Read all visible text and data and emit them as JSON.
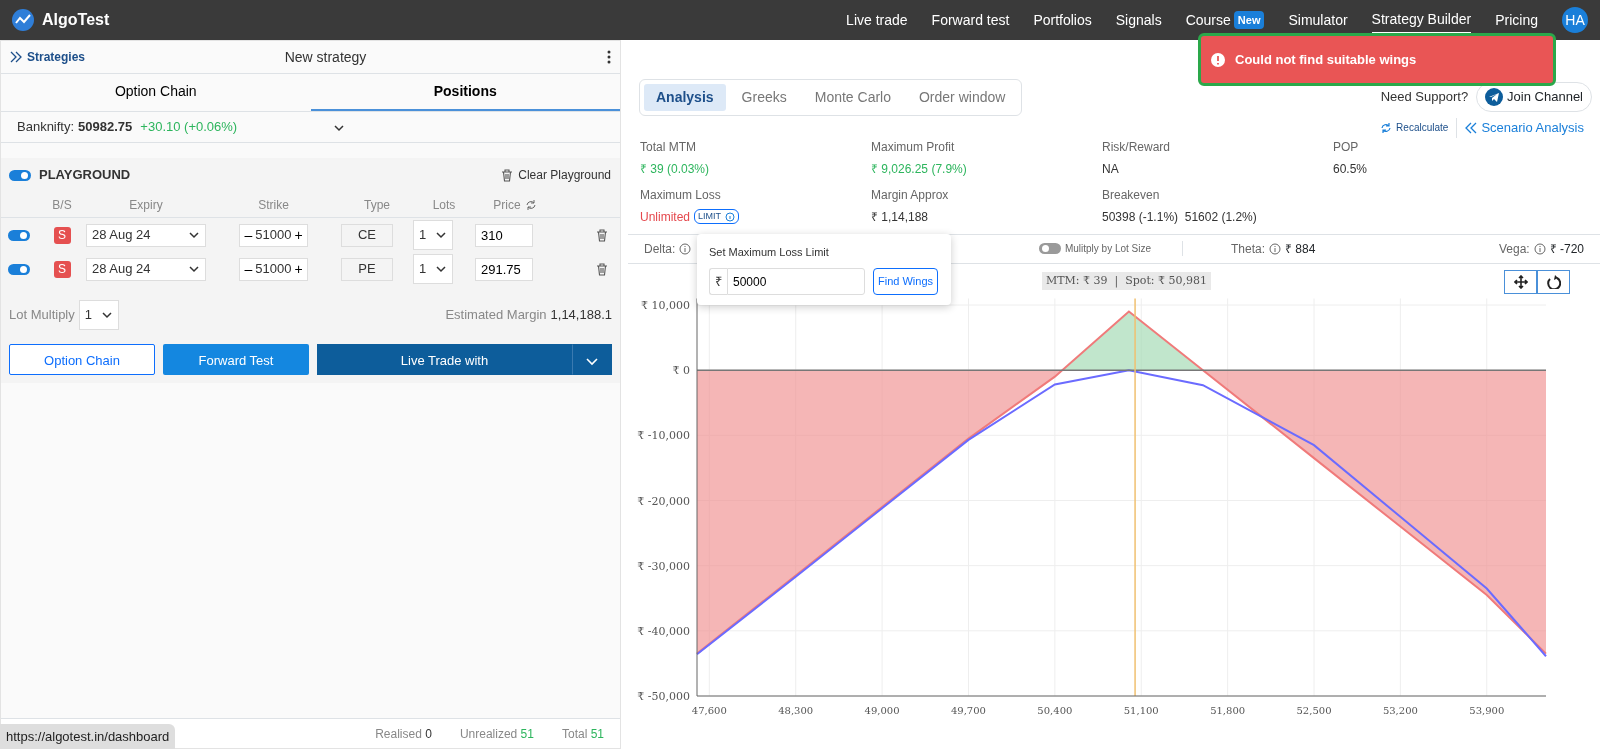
{
  "brand": "AlgoTest",
  "nav": [
    {
      "label": "Live trade",
      "selected": false
    },
    {
      "label": "Forward test",
      "selected": false
    },
    {
      "label": "Portfolios",
      "selected": false
    },
    {
      "label": "Signals",
      "selected": false
    },
    {
      "label": "Course",
      "badge": "New",
      "selected": false
    },
    {
      "label": "Simulator",
      "selected": false
    },
    {
      "label": "Strategy Builder",
      "selected": true
    },
    {
      "label": "Pricing",
      "selected": false
    }
  ],
  "avatar": "HA",
  "toast": {
    "message": "Could not find suitable wings"
  },
  "left": {
    "strategies_link": "Strategies",
    "title": "New strategy",
    "tabs": [
      {
        "label": "Option Chain",
        "selected": false
      },
      {
        "label": "Positions",
        "selected": true
      }
    ],
    "underlying": {
      "label": "Banknifty:",
      "price": "50982.75",
      "change": "+30.10 (+0.06%)"
    },
    "playground": {
      "label": "PLAYGROUND",
      "on": true,
      "clear": "Clear Playground"
    },
    "columns": [
      "B/S",
      "Expiry",
      "Strike",
      "Type",
      "Lots",
      "Price"
    ],
    "legs": [
      {
        "on": true,
        "side": "S",
        "expiry": "28 Aug 24",
        "minus": "–",
        "strike": "51000",
        "plus": "+",
        "type": "CE",
        "lots": "1",
        "price": "310"
      },
      {
        "on": true,
        "side": "S",
        "expiry": "28 Aug 24",
        "minus": "–",
        "strike": "51000",
        "plus": "+",
        "type": "PE",
        "lots": "1",
        "price": "291.75"
      }
    ],
    "lot_multiply": {
      "label": "Lot Multiply",
      "value": "1"
    },
    "margin": {
      "label": "Estimated Margin",
      "value": "1,14,188.1"
    },
    "buttons": [
      "Option Chain",
      "Forward Test",
      "Live Trade with"
    ],
    "footer": [
      {
        "label": "Realised",
        "value": "0",
        "kind": "plain"
      },
      {
        "label": "Unrealized",
        "value": "51",
        "kind": "positive"
      },
      {
        "label": "Total",
        "value": "51",
        "kind": "positive"
      }
    ]
  },
  "right": {
    "tabs": [
      {
        "label": "Analysis",
        "selected": true
      },
      {
        "label": "Greeks",
        "selected": false
      },
      {
        "label": "Monte Carlo",
        "selected": false
      },
      {
        "label": "Order window",
        "selected": false
      }
    ],
    "support": "Need Support?",
    "join": "Join Channel",
    "recalculate": "Recalculate",
    "scenario": "Scenario Analysis",
    "metrics": [
      {
        "label": "Total MTM",
        "value": "₹ 39 (0.03%)",
        "kind": "positive"
      },
      {
        "label": "Maximum Profit",
        "value": "₹ 9,026.25 (7.9%)",
        "kind": "positive"
      },
      {
        "label": "Risk/Reward",
        "value": "NA",
        "kind": "plain"
      },
      {
        "label": "POP",
        "value": "60.5%",
        "kind": "plain"
      },
      {
        "label": "Maximum Loss",
        "value": "Unlimited",
        "kind": "negative",
        "badge": "LIMIT"
      },
      {
        "label": "Margin Approx",
        "value": "₹ 1,14,188",
        "kind": "plain"
      },
      {
        "label": "Breakeven",
        "value": "50398 (-1.1%)  51602 (1.2%)",
        "kind": "plain"
      }
    ],
    "greeks": {
      "delta": "Delta:",
      "multiply": {
        "label": "Mulitply by Lot Size",
        "on": false
      },
      "theta": {
        "label": "Theta:",
        "value": "₹ 884"
      },
      "vega": {
        "label": "Vega:",
        "value": "₹ -720"
      }
    },
    "popover": {
      "title": "Set Maximum Loss Limit",
      "currency": "₹",
      "value": "50000",
      "button": "Find Wings"
    },
    "chart_header": "MTM: ₹ 39  |  Spot: ₹ 50,981",
    "chart_data": {
      "type": "line",
      "x": [
        47500,
        48300,
        49000,
        49700,
        50400,
        51000,
        51600,
        52500,
        53200,
        53900,
        54380
      ],
      "series": [
        {
          "color": "#f07a7a",
          "values": [
            -43500,
            -31500,
            -21000,
            -10500,
            -1000,
            9000,
            0,
            -13500,
            -24000,
            -34500,
            -43500
          ]
        },
        {
          "color": "#6b6bff",
          "values": [
            -43600,
            -31700,
            -21200,
            -10700,
            -2200,
            0,
            -2300,
            -11500,
            -22500,
            -33500,
            -43900
          ]
        }
      ],
      "xlim": [
        47500,
        54380
      ],
      "ylim": [
        -50000,
        11000
      ],
      "grid": true,
      "xticks": [
        {
          "value": 47600,
          "label": "47,600"
        },
        {
          "value": 48300,
          "label": "48,300"
        },
        {
          "value": 49000,
          "label": "49,000"
        },
        {
          "value": 49700,
          "label": "49,700"
        },
        {
          "value": 50400,
          "label": "50,400"
        },
        {
          "value": 51100,
          "label": "51,100"
        },
        {
          "value": 51800,
          "label": "51,800"
        },
        {
          "value": 52500,
          "label": "52,500"
        },
        {
          "value": 53200,
          "label": "53,200"
        },
        {
          "value": 53900,
          "label": "53,900"
        }
      ],
      "yticks": [
        {
          "value": 10000,
          "label": "₹ 10,000"
        },
        {
          "value": 0,
          "label": "₹ 0"
        },
        {
          "value": -10000,
          "label": "₹ -10,000"
        },
        {
          "value": -20000,
          "label": "₹ -20,000"
        },
        {
          "value": -30000,
          "label": "₹ -30,000"
        },
        {
          "value": -40000,
          "label": "₹ -40,000"
        },
        {
          "value": -50000,
          "label": "₹ -50,000"
        }
      ],
      "ref_lines": [
        {
          "axis": "x",
          "value": 51050,
          "color": "#f0c070"
        }
      ]
    }
  },
  "status_url": "https://algotest.in/dashboard"
}
